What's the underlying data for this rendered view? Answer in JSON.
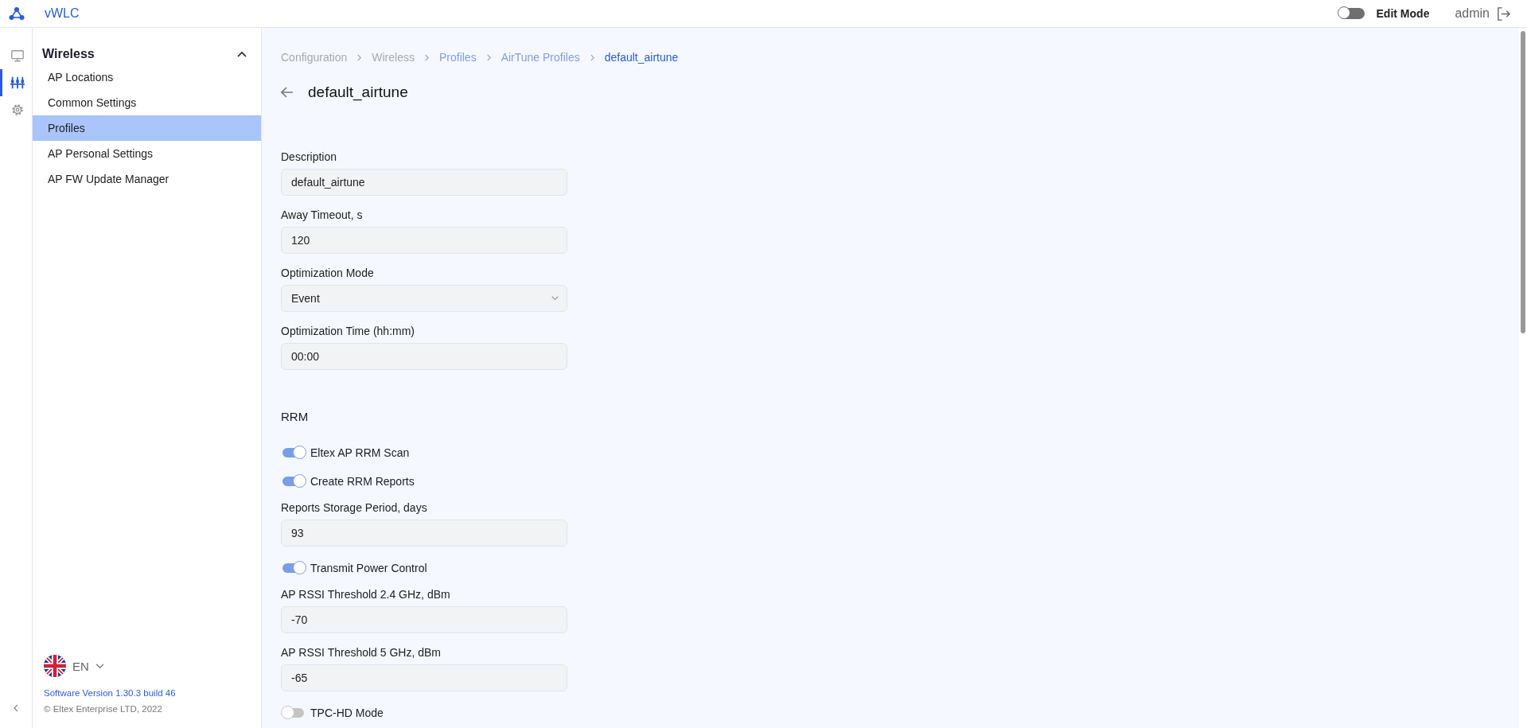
{
  "header": {
    "app_name": "vWLC",
    "edit_mode": {
      "label": "Edit Mode",
      "on": false
    },
    "user": "admin"
  },
  "rail": [
    {
      "kind": "monitor",
      "selected": false
    },
    {
      "kind": "sliders",
      "selected": true
    },
    {
      "kind": "settings",
      "selected": false
    }
  ],
  "sidebar": {
    "section": {
      "title": "Wireless",
      "expanded": true
    },
    "items": [
      {
        "label": "AP Locations",
        "selected": false
      },
      {
        "label": "Common Settings",
        "selected": false
      },
      {
        "label": "Profiles",
        "selected": true
      },
      {
        "label": "AP Personal Settings",
        "selected": false
      },
      {
        "label": "AP FW Update Manager",
        "selected": false
      }
    ],
    "language": "EN",
    "version": "Software Version 1.30.3 build 46",
    "copyright": "© Eltex Enterprise LTD, 2022"
  },
  "breadcrumb": [
    {
      "label": "Configuration",
      "kind": "inactive"
    },
    {
      "label": "Wireless",
      "kind": "inactive"
    },
    {
      "label": "Profiles",
      "kind": "link"
    },
    {
      "label": "AirTune Profiles",
      "kind": "link"
    },
    {
      "label": "default_airtune",
      "kind": "current"
    }
  ],
  "page_title": "default_airtune",
  "general": [
    {
      "kind": "text",
      "label": "Description",
      "value": "default_airtune"
    },
    {
      "kind": "text",
      "label": "Away Timeout, s",
      "value": "120"
    },
    {
      "kind": "select",
      "label": "Optimization Mode",
      "value": "Event"
    },
    {
      "kind": "text",
      "label": "Optimization Time (hh:mm)",
      "value": "00:00"
    }
  ],
  "rrm": {
    "title": "RRM",
    "items": [
      {
        "kind": "toggle",
        "label": "Eltex AP RRM Scan",
        "on": true
      },
      {
        "kind": "toggle",
        "label": "Create RRM Reports",
        "on": true
      },
      {
        "kind": "text",
        "label": "Reports Storage Period, days",
        "value": "93"
      },
      {
        "kind": "toggle",
        "label": "Transmit Power Control",
        "on": true
      },
      {
        "kind": "text",
        "label": "AP RSSI Threshold 2.4 GHz, dBm",
        "value": "-70"
      },
      {
        "kind": "text",
        "label": "AP RSSI Threshold 5 GHz, dBm",
        "value": "-65"
      },
      {
        "kind": "toggle",
        "label": "TPC-HD Mode",
        "on": false
      }
    ]
  }
}
